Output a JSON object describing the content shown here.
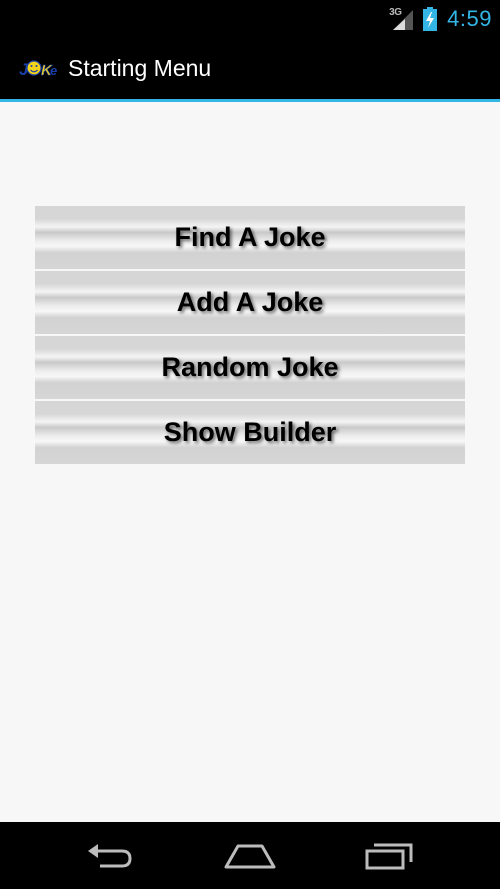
{
  "status_bar": {
    "network_type": "3G",
    "time": "4:59",
    "accent_color": "#33b5e5"
  },
  "action_bar": {
    "logo_icon": "joke-logo-icon",
    "title": "Starting Menu"
  },
  "menu": {
    "items": [
      {
        "label": "Find A Joke"
      },
      {
        "label": "Add A Joke"
      },
      {
        "label": "Random Joke"
      },
      {
        "label": "Show Builder"
      }
    ]
  },
  "nav_bar": {
    "icons": [
      "back-icon",
      "home-icon",
      "recent-apps-icon"
    ]
  }
}
